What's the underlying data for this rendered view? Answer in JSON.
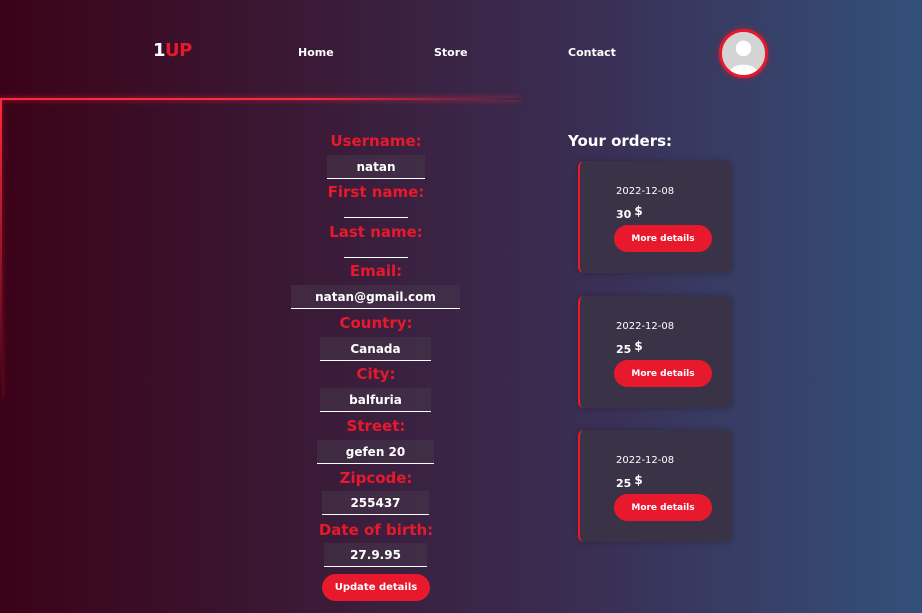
{
  "header": {
    "logo_one": "1",
    "logo_up": "UP",
    "nav": {
      "home": "Home",
      "store": "Store",
      "contact": "Contact"
    },
    "avatar_icon": "user-avatar-icon"
  },
  "profile": {
    "username_label": "Username:",
    "username": "natan",
    "first_name_label": "First name:",
    "first_name": "",
    "last_name_label": "Last name:",
    "last_name": "",
    "email_label": "Email:",
    "email": "natan@gmail.com",
    "country_label": "Country:",
    "country": "Canada",
    "city_label": "City:",
    "city": "balfuria",
    "street_label": "Street:",
    "street": "gefen 20",
    "zipcode_label": "Zipcode:",
    "zipcode": "255437",
    "dob_label": "Date of birth:",
    "dob": "27.9.95",
    "update_label": "Update details"
  },
  "orders": {
    "title": "Your orders:",
    "currency": "$",
    "details_label": "More details",
    "items": [
      {
        "date": "2022-12-08",
        "price": "30"
      },
      {
        "date": "2022-12-08",
        "price": "25"
      },
      {
        "date": "2022-12-08",
        "price": "25"
      }
    ]
  },
  "colors": {
    "accent": "#e8192c",
    "card": "#3a3348"
  }
}
